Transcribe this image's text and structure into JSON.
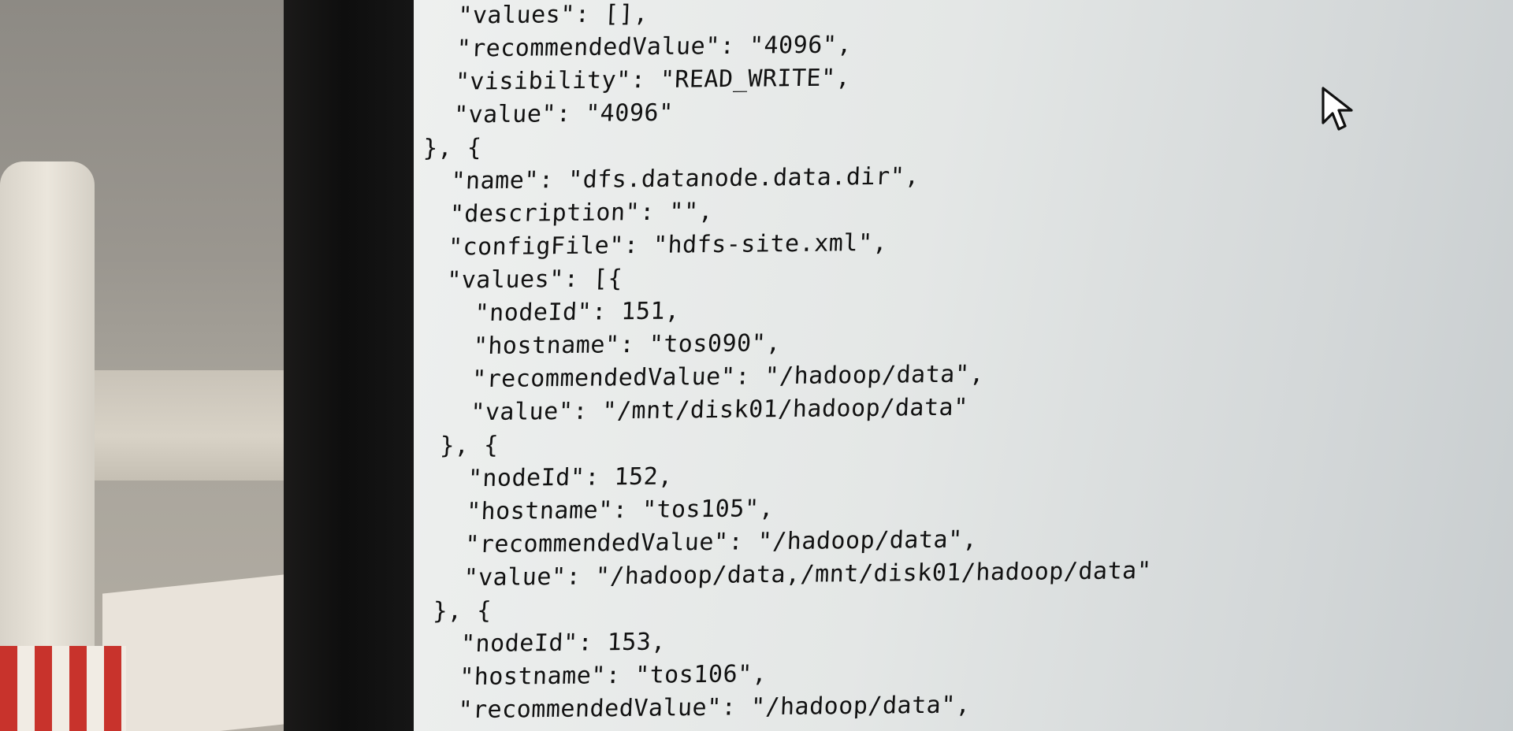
{
  "editor": {
    "lines": [
      "  \"values\": [],",
      "  \"recommendedValue\": \"4096\",",
      "  \"visibility\": \"READ_WRITE\",",
      "  \"value\": \"4096\"",
      "}, {",
      "  \"name\": \"dfs.datanode.data.dir\",",
      "  \"description\": \"\",",
      "  \"configFile\": \"hdfs-site.xml\",",
      "  \"values\": [{",
      "    \"nodeId\": 151,",
      "    \"hostname\": \"tos090\",",
      "    \"recommendedValue\": \"/hadoop/data\",",
      "    \"value\": \"/mnt/disk01/hadoop/data\"",
      "  }, {",
      "    \"nodeId\": 152,",
      "    \"hostname\": \"tos105\",",
      "    \"recommendedValue\": \"/hadoop/data\",",
      "    \"value\": \"/hadoop/data,/mnt/disk01/hadoop/data\"",
      "  }, {",
      "    \"nodeId\": 153,",
      "    \"hostname\": \"tos106\",",
      "    \"recommendedValue\": \"/hadoop/data\","
    ]
  },
  "icons": {
    "cursor": "mouse-pointer-icon"
  }
}
